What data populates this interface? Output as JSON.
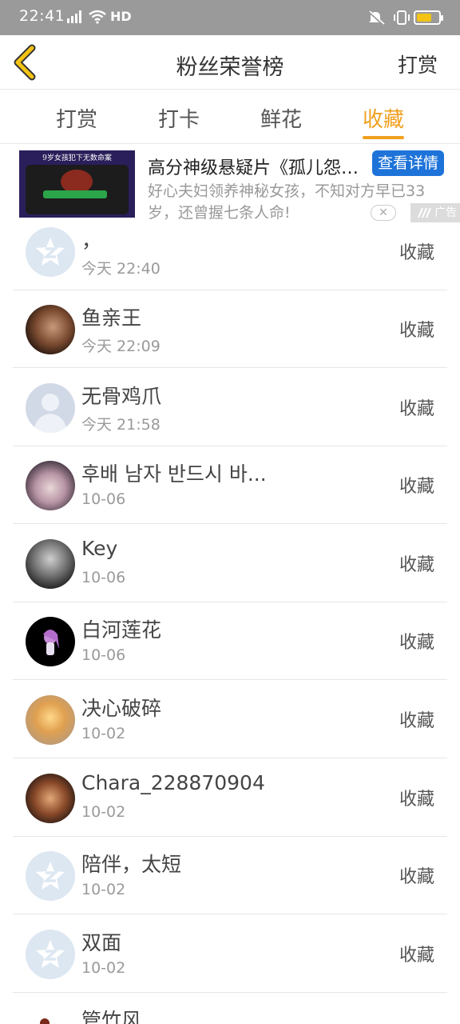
{
  "status_bar": {
    "time": "22:41",
    "network": "4G",
    "hd": "HD",
    "battery_level": 0.7,
    "battery_color": "#f3c316"
  },
  "header": {
    "back_icon": "back-arrow-icon",
    "title": "粉丝荣誉榜",
    "action": "打赏",
    "accent_color": "#f0a020"
  },
  "tabs": [
    {
      "label": "打赏",
      "active": false
    },
    {
      "label": "打卡",
      "active": false
    },
    {
      "label": "鲜花",
      "active": false
    },
    {
      "label": "收藏",
      "active": true
    }
  ],
  "ad": {
    "thumb_caption": "9岁女孩犯下无数命案",
    "title": "高分神级悬疑片《孤儿怨…",
    "detail_button": "查看详情",
    "description": "好心夫妇领养神秘女孩，不知对方早已33岁，还曾握七条人命!",
    "close": "✕",
    "tag": "广告"
  },
  "list": [
    {
      "name": "，",
      "time": "今天 22:40",
      "action": "收藏",
      "avatar": "default"
    },
    {
      "name": "鱼亲王",
      "time": "今天 22:09",
      "action": "收藏",
      "avatar": "photo-man"
    },
    {
      "name": "无骨鸡爪",
      "time": "今天 21:58",
      "action": "收藏",
      "avatar": "silhouette"
    },
    {
      "name": "후배 남자 반드시 바...",
      "time": "10-06",
      "action": "收藏",
      "avatar": "photo-girl"
    },
    {
      "name": "Key",
      "time": "10-06",
      "action": "收藏",
      "avatar": "photo-bw"
    },
    {
      "name": "白河莲花",
      "time": "10-06",
      "action": "收藏",
      "avatar": "photo-anime-purple"
    },
    {
      "name": "决心破碎",
      "time": "10-02",
      "action": "收藏",
      "avatar": "photo-warm"
    },
    {
      "name": "Chara_228870904",
      "time": "10-02",
      "action": "收藏",
      "avatar": "photo-anime-red"
    },
    {
      "name": "陪伴，太短",
      "time": "10-02",
      "action": "收藏",
      "avatar": "default"
    },
    {
      "name": "双面",
      "time": "10-02",
      "action": "收藏",
      "avatar": "default"
    },
    {
      "name": "管竹风",
      "time": "",
      "action": "",
      "avatar": "photo-small"
    }
  ]
}
